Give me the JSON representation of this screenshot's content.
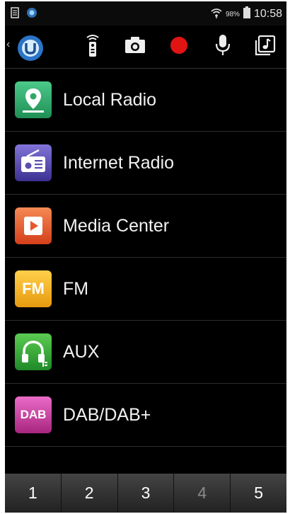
{
  "status_bar": {
    "battery_pct": "98%",
    "time": "10:58",
    "icons": [
      "notes-icon",
      "app-icon",
      "wifi-icon",
      "battery-icon"
    ]
  },
  "toolbar": {
    "buttons": [
      "remote-icon",
      "camera-icon",
      "record-icon",
      "microphone-icon",
      "music-library-icon"
    ],
    "record_color": "#e11414"
  },
  "menu": {
    "items": [
      {
        "label": "Local Radio",
        "icon": "local-radio-icon",
        "color": "#2fa86a"
      },
      {
        "label": "Internet Radio",
        "icon": "internet-radio-icon",
        "color": "#5a4fb0"
      },
      {
        "label": "Media Center",
        "icon": "media-center-icon",
        "color": "#e8572a"
      },
      {
        "label": "FM",
        "icon": "fm-icon",
        "color": "#f0b21b"
      },
      {
        "label": "AUX",
        "icon": "aux-icon",
        "color": "#3aa63a"
      },
      {
        "label": "DAB/DAB+",
        "icon": "dab-icon",
        "color": "#c23aa0"
      }
    ],
    "fm_icon_text": "FM",
    "dab_icon_text": "DAB"
  },
  "presets": {
    "items": [
      "1",
      "2",
      "3",
      "4",
      "5"
    ],
    "disabled_index": 3
  }
}
